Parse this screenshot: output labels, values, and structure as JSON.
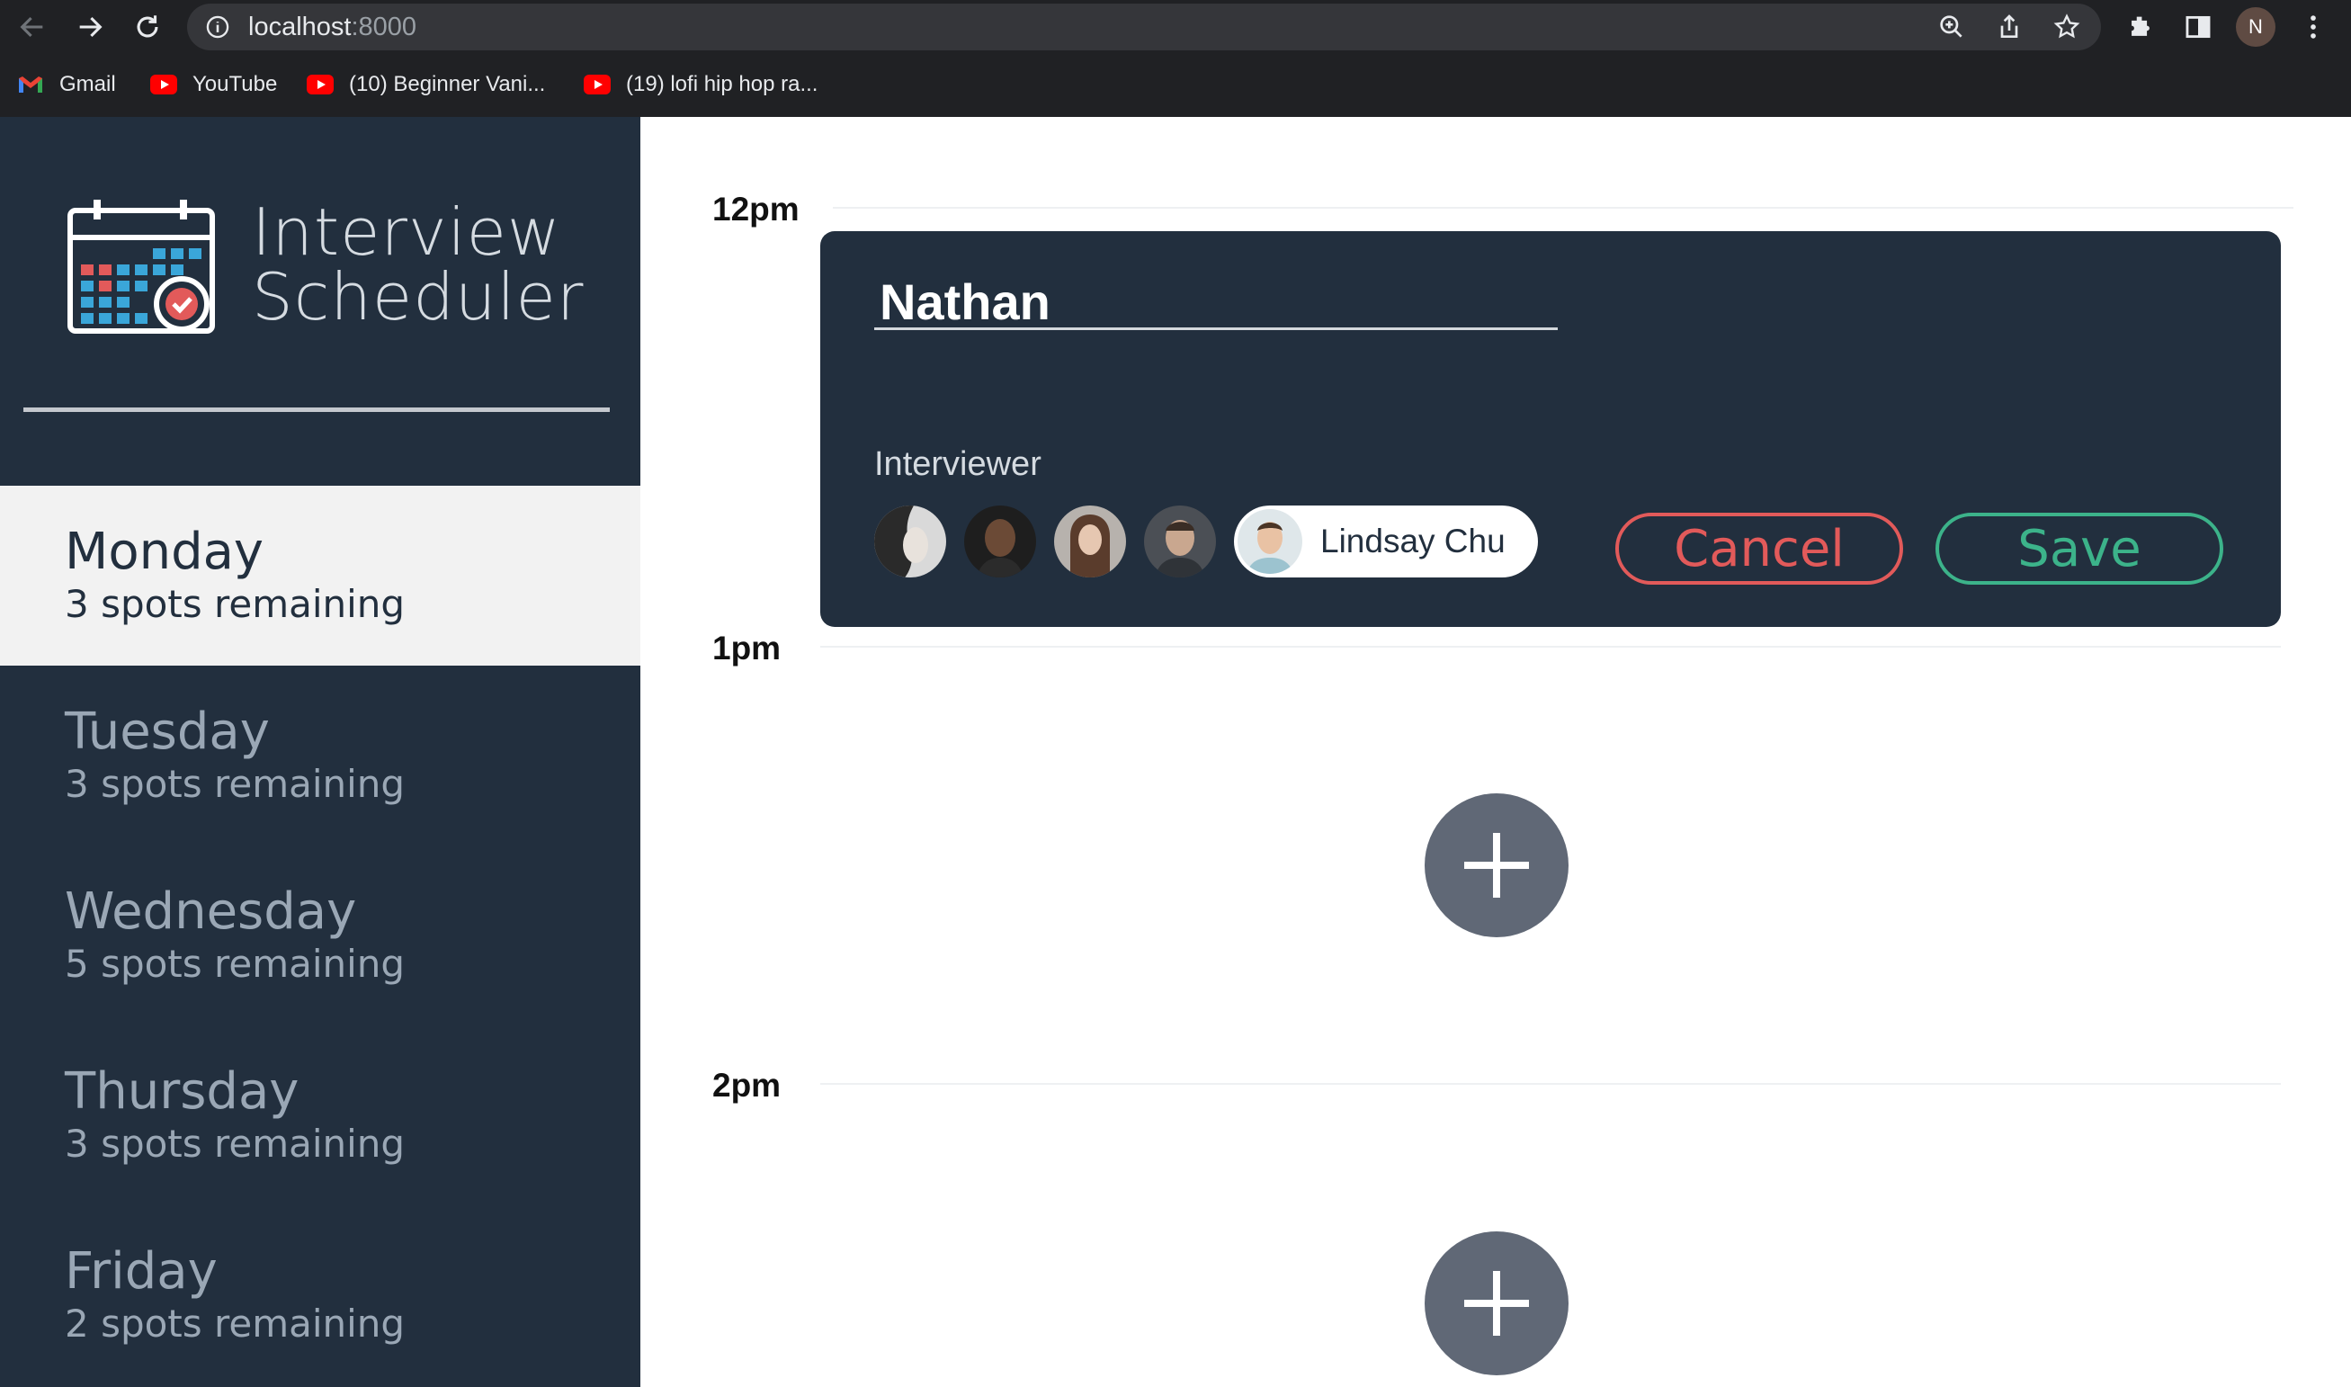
{
  "browser": {
    "url_host": "localhost",
    "url_port": ":8000",
    "profile_initial": "N",
    "bookmarks": [
      {
        "label": "Gmail",
        "icon": "gmail-icon"
      },
      {
        "label": "YouTube",
        "icon": "youtube-icon"
      },
      {
        "label": "(10) Beginner Vani...",
        "icon": "youtube-icon"
      },
      {
        "label": "(19) lofi hip hop ra...",
        "icon": "youtube-icon"
      }
    ]
  },
  "sidebar": {
    "brand_line1": "Interview",
    "brand_line2": "Scheduler",
    "days": [
      {
        "name": "Monday",
        "spots": "3 spots remaining",
        "selected": true
      },
      {
        "name": "Tuesday",
        "spots": "3 spots remaining",
        "selected": false
      },
      {
        "name": "Wednesday",
        "spots": "5 spots remaining",
        "selected": false
      },
      {
        "name": "Thursday",
        "spots": "3 spots remaining",
        "selected": false
      },
      {
        "name": "Friday",
        "spots": "2 spots remaining",
        "selected": false
      }
    ]
  },
  "schedule": {
    "hours": [
      "12pm",
      "1pm",
      "2pm"
    ],
    "form": {
      "student_name": "Nathan",
      "interviewer_label": "Interviewer",
      "selected_interviewer": "Lindsay Chu",
      "cancel_label": "Cancel",
      "save_label": "Save"
    }
  },
  "colors": {
    "sidebar_bg": "#222f3e",
    "cancel": "#e25a5a",
    "save": "#3cb38a",
    "add_button": "#606876"
  }
}
